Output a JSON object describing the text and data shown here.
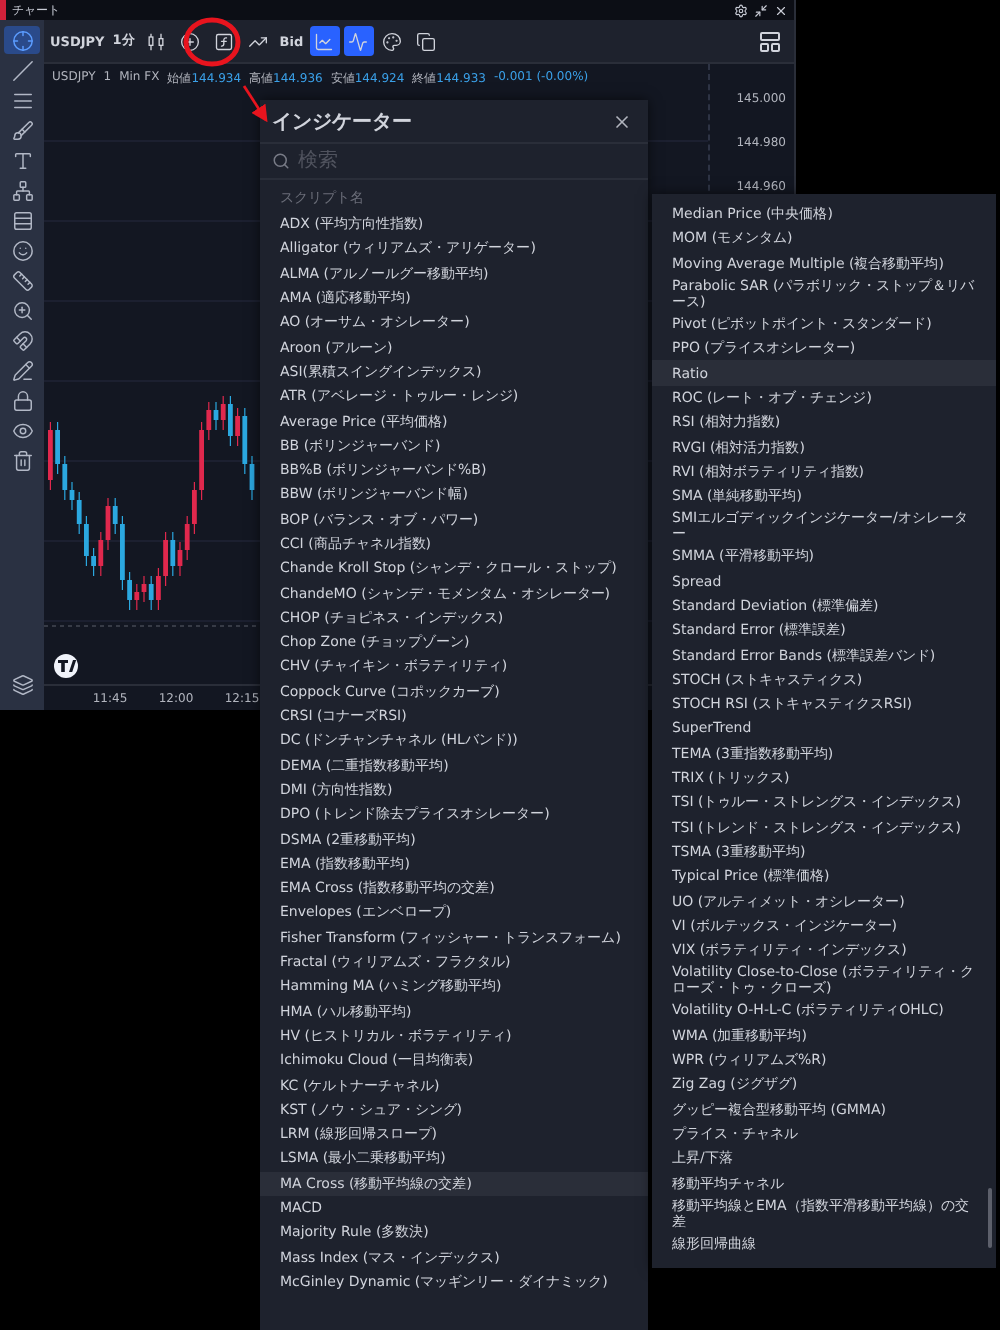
{
  "window": {
    "title": "チャート"
  },
  "toolbar": {
    "items": [
      {
        "kind": "text",
        "label": "USDJPY"
      },
      {
        "kind": "text",
        "label": "1分"
      },
      {
        "kind": "candles"
      },
      {
        "kind": "plus"
      },
      {
        "kind": "function"
      },
      {
        "kind": "indicator"
      },
      {
        "kind": "text",
        "label": "Bid"
      },
      {
        "kind": "line-chart",
        "selected": true
      },
      {
        "kind": "wave",
        "selected": true
      },
      {
        "kind": "palette"
      },
      {
        "kind": "copy"
      }
    ]
  },
  "sidebar": {
    "tools": [
      {
        "kind": "crosshair",
        "selected": true
      },
      {
        "kind": "trend-line",
        "selected": false
      },
      {
        "kind": "parallel-lines",
        "selected": false
      },
      {
        "kind": "brush",
        "selected": false
      },
      {
        "kind": "text",
        "selected": false
      },
      {
        "kind": "pattern",
        "selected": false
      },
      {
        "kind": "levels",
        "selected": false
      },
      {
        "kind": "smile",
        "selected": false
      },
      {
        "kind": "ruler",
        "selected": false
      },
      {
        "kind": "zoom",
        "selected": false
      },
      {
        "kind": "magnet",
        "selected": false
      },
      {
        "kind": "pencil",
        "selected": false
      },
      {
        "kind": "lock",
        "selected": false
      },
      {
        "kind": "eye",
        "selected": false
      },
      {
        "kind": "trash",
        "selected": false
      }
    ],
    "bottom_tools": [
      {
        "kind": "layers",
        "selected": false
      }
    ]
  },
  "legend": {
    "symbol": "USDJPY",
    "interval": "1",
    "market": "Min FX",
    "ohlc": [
      {
        "label": "始値",
        "value": "144.934"
      },
      {
        "label": "高値",
        "value": "144.936"
      },
      {
        "label": "安値",
        "value": "144.924"
      },
      {
        "label": "終値",
        "value": "144.933"
      }
    ],
    "change": "-0.001 (-0.00%)"
  },
  "price_axis": [
    "145.000",
    "144.980",
    "144.960"
  ],
  "time_axis": [
    "11:45",
    "12:00",
    "12:15"
  ],
  "indicators": {
    "title": "インジケーター",
    "search": {
      "placeholder": "検索"
    },
    "column_header": "スクリプト名",
    "items": [
      {
        "label": "ADX (平均方向性指数)",
        "selected": false
      },
      {
        "label": "Alligator (ウィリアムズ・アリゲーター)",
        "selected": false
      },
      {
        "label": "ALMA (アルノールグー移動平均)",
        "selected": false
      },
      {
        "label": "AMA (適応移動平均)",
        "selected": false
      },
      {
        "label": "AO (オーサム・オシレーター)",
        "selected": false
      },
      {
        "label": "Aroon (アルーン)",
        "selected": false
      },
      {
        "label": "ASI(累積スイングインデックス)",
        "selected": false
      },
      {
        "label": "ATR (アベレージ・トゥルー・レンジ)",
        "selected": false
      },
      {
        "label": "Average Price (平均価格)",
        "selected": false
      },
      {
        "label": "BB (ボリンジャーバンド)",
        "selected": false
      },
      {
        "label": "BB%B (ボリンジャーバンド%B)",
        "selected": false
      },
      {
        "label": "BBW (ボリンジャーバンド幅)",
        "selected": false
      },
      {
        "label": "BOP (バランス・オブ・パワー)",
        "selected": false
      },
      {
        "label": "CCI (商品チャネル指数)",
        "selected": false
      },
      {
        "label": "Chande Kroll Stop (シャンデ・クロール・ストップ)",
        "selected": false
      },
      {
        "label": "ChandeMO (シャンデ・モメンタム・オシレーター)",
        "selected": false
      },
      {
        "label": "CHOP (チョピネス・インデックス)",
        "selected": false
      },
      {
        "label": "Chop Zone (チョップゾーン)",
        "selected": false
      },
      {
        "label": "CHV (チャイキン・ボラティリティ)",
        "selected": false
      },
      {
        "label": "Coppock Curve (コポックカーブ)",
        "selected": false
      },
      {
        "label": "CRSI (コナーズRSI)",
        "selected": false
      },
      {
        "label": "DC (ドンチャンチャネル (HLバンド))",
        "selected": false
      },
      {
        "label": "DEMA (二重指数移動平均)",
        "selected": false
      },
      {
        "label": "DMI (方向性指数)",
        "selected": false
      },
      {
        "label": "DPO (トレンド除去プライスオシレーター)",
        "selected": false
      },
      {
        "label": "DSMA (2重移動平均)",
        "selected": false
      },
      {
        "label": "EMA (指数移動平均)",
        "selected": false
      },
      {
        "label": "EMA Cross (指数移動平均の交差)",
        "selected": false
      },
      {
        "label": "Envelopes (エンベロープ)",
        "selected": false
      },
      {
        "label": "Fisher Transform (フィッシャー・トランスフォーム)",
        "selected": false
      },
      {
        "label": "Fractal (ウィリアムズ・フラクタル)",
        "selected": false
      },
      {
        "label": "Hamming MA (ハミング移動平均)",
        "selected": false
      },
      {
        "label": "HMA (ハル移動平均)",
        "selected": false
      },
      {
        "label": "HV (ヒストリカル・ボラティリティ)",
        "selected": false
      },
      {
        "label": "Ichimoku Cloud (一目均衡表)",
        "selected": false
      },
      {
        "label": "KC (ケルトナーチャネル)",
        "selected": false
      },
      {
        "label": "KST (ノウ・シュア・シング)",
        "selected": false
      },
      {
        "label": "LRM (線形回帰スロープ)",
        "selected": false
      },
      {
        "label": "LSMA (最小二乗移動平均)",
        "selected": false
      },
      {
        "label": "MA Cross (移動平均線の交差)",
        "selected": true
      },
      {
        "label": "MACD",
        "selected": false
      },
      {
        "label": "Majority Rule (多数決)",
        "selected": false
      },
      {
        "label": "Mass Index (マス・インデックス)",
        "selected": false
      },
      {
        "label": "McGinley Dynamic (マッギンリー・ダイナミック)",
        "selected": false
      }
    ]
  },
  "indicators_continued": {
    "items": [
      {
        "label": "Median Price (中央価格)",
        "selected": false
      },
      {
        "label": "MOM (モメンタム)",
        "selected": false
      },
      {
        "label": "Moving Average Multiple (複合移動平均)",
        "selected": false
      },
      {
        "label": "Parabolic SAR (パラボリック・ストップ＆リバース)",
        "selected": false
      },
      {
        "label": "Pivot (ピボットポイント・スタンダード)",
        "selected": false
      },
      {
        "label": "PPO (プライスオシレーター)",
        "selected": false
      },
      {
        "label": "Ratio",
        "selected": true
      },
      {
        "label": "ROC (レート・オブ・チェンジ)",
        "selected": false
      },
      {
        "label": "RSI (相対力指数)",
        "selected": false
      },
      {
        "label": "RVGI (相対活力指数)",
        "selected": false
      },
      {
        "label": "RVI (相対ボラティリティ指数)",
        "selected": false
      },
      {
        "label": "SMA (単純移動平均)",
        "selected": false
      },
      {
        "label": "SMIエルゴディックインジケーター/オシレーター",
        "selected": false
      },
      {
        "label": "SMMA (平滑移動平均)",
        "selected": false
      },
      {
        "label": "Spread",
        "selected": false
      },
      {
        "label": "Standard Deviation (標準偏差)",
        "selected": false
      },
      {
        "label": "Standard Error (標準誤差)",
        "selected": false
      },
      {
        "label": "Standard Error Bands (標準誤差バンド)",
        "selected": false
      },
      {
        "label": "STOCH (ストキャスティクス)",
        "selected": false
      },
      {
        "label": "STOCH RSI (ストキャスティクスRSI)",
        "selected": false
      },
      {
        "label": "SuperTrend",
        "selected": false
      },
      {
        "label": "TEMA (3重指数移動平均)",
        "selected": false
      },
      {
        "label": "TRIX (トリックス)",
        "selected": false
      },
      {
        "label": "TSI (トゥルー・ストレングス・インデックス)",
        "selected": false
      },
      {
        "label": "TSI (トレンド・ストレングス・インデックス)",
        "selected": false
      },
      {
        "label": "TSMA (3重移動平均)",
        "selected": false
      },
      {
        "label": "Typical Price (標準価格)",
        "selected": false
      },
      {
        "label": "UO (アルティメット・オシレーター)",
        "selected": false
      },
      {
        "label": "VI (ボルテックス・インジケーター)",
        "selected": false
      },
      {
        "label": "VIX (ボラティリティ・インデックス)",
        "selected": false
      },
      {
        "label": "Volatility Close-to-Close (ボラティリティ・クローズ・トゥ・クローズ)",
        "selected": false
      },
      {
        "label": "Volatility O-H-L-C (ボラティリティOHLC)",
        "selected": false
      },
      {
        "label": "WMA (加重移動平均)",
        "selected": false
      },
      {
        "label": "WPR (ウィリアムズ%R)",
        "selected": false
      },
      {
        "label": "Zig Zag (ジグザグ)",
        "selected": false
      },
      {
        "label": "グッピー複合型移動平均 (GMMA)",
        "selected": false
      },
      {
        "label": "プライス・チャネル",
        "selected": false
      },
      {
        "label": "上昇/下落",
        "selected": false
      },
      {
        "label": "移動平均チャネル",
        "selected": false
      },
      {
        "label": "移動平均線とEMA（指数平滑移動平均線）の交差",
        "selected": false
      },
      {
        "label": "線形回帰曲線",
        "selected": false
      }
    ]
  }
}
